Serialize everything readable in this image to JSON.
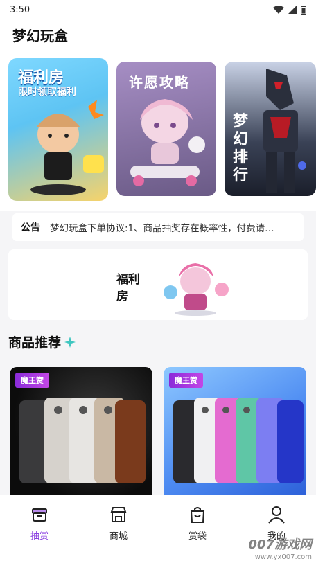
{
  "status_bar": {
    "time": "3:50"
  },
  "header": {
    "title": "梦幻玩盒"
  },
  "banners": {
    "welfare": {
      "line1": "福利房",
      "line2": "限时领取福利"
    },
    "wish": {
      "title": "许愿攻略"
    },
    "rank": {
      "title": "梦幻排行"
    }
  },
  "notice": {
    "tag": "公告",
    "text": "梦幻玩盒下单协议:1、商品抽奖存在概率性，付费请…"
  },
  "welfare_banner": {
    "label": "福利房"
  },
  "section": {
    "title": "商品推荐"
  },
  "products": [
    {
      "badge": "魔王赏"
    },
    {
      "badge": "魔王赏"
    }
  ],
  "tabs": [
    {
      "label": "抽赏",
      "icon": "box-icon",
      "active": true
    },
    {
      "label": "商城",
      "icon": "store-icon",
      "active": false
    },
    {
      "label": "赏袋",
      "icon": "bag-icon",
      "active": false
    },
    {
      "label": "我的",
      "icon": "user-icon",
      "active": false
    }
  ],
  "watermark": {
    "text": "007游戏网",
    "url": "www.yx007.com"
  },
  "colors": {
    "accent": "#8a3ee0",
    "badge": "#a13fe0"
  }
}
